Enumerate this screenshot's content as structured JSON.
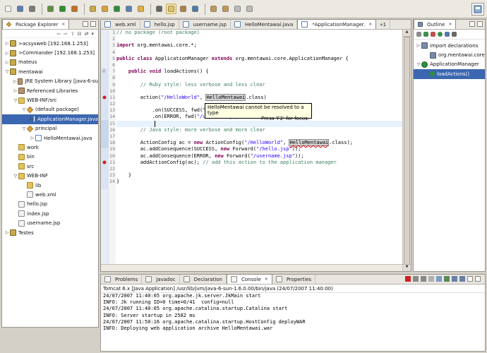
{
  "toolbar": {
    "icons": [
      "new-icon",
      "save-icon",
      "print-icon",
      "debug-icon",
      "run-icon",
      "external-tools-icon",
      "new-project-icon",
      "new-package-icon",
      "new-class-icon",
      "open-type-icon",
      "search-icon",
      "pin-icon",
      "mark-occurrences-icon",
      "annotation-icon",
      "web-icon",
      "next-annotation-icon",
      "prev-annotation-icon",
      "back-icon",
      "forward-icon"
    ],
    "perspective_icon": "java-perspective-icon"
  },
  "package_explorer": {
    "tab_label": "Package Explorer",
    "tab_close": "✕",
    "items": [
      {
        "indent": 0,
        "twisty": "▷",
        "icon": "project",
        "label": ">acsysweb  [192.168.1.253]"
      },
      {
        "indent": 0,
        "twisty": "▷",
        "icon": "project",
        "label": ">Commander  [192.168.1.253]"
      },
      {
        "indent": 0,
        "twisty": "▷",
        "icon": "project",
        "label": "mateus"
      },
      {
        "indent": 0,
        "twisty": "▽",
        "icon": "project",
        "label": "mentawai"
      },
      {
        "indent": 1,
        "twisty": "▷",
        "icon": "jar",
        "label": "JRE System Library [java-6-su"
      },
      {
        "indent": 1,
        "twisty": "▷",
        "icon": "jar",
        "label": "Referenced Libraries"
      },
      {
        "indent": 1,
        "twisty": "▽",
        "icon": "folder",
        "label": "WEB-INF/src"
      },
      {
        "indent": 2,
        "twisty": "▽",
        "icon": "pkg",
        "label": "(default package)"
      },
      {
        "indent": 3,
        "twisty": "▷",
        "icon": "java",
        "label": "ApplicationManager.java",
        "selected": true
      },
      {
        "indent": 2,
        "twisty": "▽",
        "icon": "pkg",
        "label": "principal"
      },
      {
        "indent": 3,
        "twisty": "▷",
        "icon": "java",
        "label": "HelloMentawai.java"
      },
      {
        "indent": 1,
        "twisty": "",
        "icon": "folder",
        "label": "work"
      },
      {
        "indent": 1,
        "twisty": "",
        "icon": "folder",
        "label": "bin"
      },
      {
        "indent": 1,
        "twisty": "",
        "icon": "folder",
        "label": "src"
      },
      {
        "indent": 1,
        "twisty": "▽",
        "icon": "folder",
        "label": "WEB-INF"
      },
      {
        "indent": 2,
        "twisty": "",
        "icon": "folder",
        "label": "lib"
      },
      {
        "indent": 2,
        "twisty": "",
        "icon": "file",
        "label": "web.xml"
      },
      {
        "indent": 1,
        "twisty": "",
        "icon": "file",
        "label": "hello.jsp"
      },
      {
        "indent": 1,
        "twisty": "",
        "icon": "file",
        "label": "index.jsp"
      },
      {
        "indent": 1,
        "twisty": "",
        "icon": "file",
        "label": "username.jsp"
      },
      {
        "indent": 0,
        "twisty": "▷",
        "icon": "project",
        "label": "Testes"
      }
    ]
  },
  "editor": {
    "tabs": [
      {
        "label": "web.xml",
        "active": false
      },
      {
        "label": "hello.jsp",
        "active": false
      },
      {
        "label": "username.jsp",
        "active": false
      },
      {
        "label": "HelloMentawai.java",
        "active": false
      },
      {
        "label": "*ApplicationManager.",
        "active": true,
        "close": "✕"
      }
    ],
    "overflow_label": "»1",
    "lines": [
      [
        {
          "t": "// no package (root package)",
          "c": "cm"
        }
      ],
      [],
      [
        {
          "t": "import",
          "c": "kw"
        },
        {
          "t": " org.mentawai.core.*;"
        }
      ],
      [],
      [
        {
          "t": "public class",
          "c": "kw"
        },
        {
          "t": " ApplicationManager "
        },
        {
          "t": "extends",
          "c": "kw"
        },
        {
          "t": " org.mentawai.core.ApplicationManager {"
        }
      ],
      [],
      [
        {
          "t": "    "
        },
        {
          "t": "public void",
          "c": "kw"
        },
        {
          "t": " loadActions() {"
        }
      ],
      [],
      [
        {
          "t": "        "
        },
        {
          "t": "// Ruby style: less verbose and less clear",
          "c": "cm"
        }
      ],
      [],
      [
        {
          "t": "        action("
        },
        {
          "t": "\"/HelloWorld\"",
          "c": "st"
        },
        {
          "t": ", "
        },
        {
          "t": "HelloMentawai",
          "c": "hl"
        },
        {
          "t": ".class)"
        }
      ],
      [],
      [
        {
          "t": "            .on(SUCCESS, fwd(\""
        }
      ],
      [
        {
          "t": "            .on(ERROR, fwd("
        },
        {
          "t": "\"/username.jsp\"",
          "c": "st"
        },
        {
          "t": "));"
        }
      ],
      [
        {
          "t": "",
          "c": "caret"
        }
      ],
      [
        {
          "t": "        "
        },
        {
          "t": "// Java style: more verbose and more clear",
          "c": "cm"
        }
      ],
      [],
      [
        {
          "t": "        ActionConfig ac = "
        },
        {
          "t": "new",
          "c": "kw"
        },
        {
          "t": " ActionConfig("
        },
        {
          "t": "\"/HelloWorld\"",
          "c": "st"
        },
        {
          "t": ", "
        },
        {
          "t": "HelloMentawai",
          "c": "hlerr"
        },
        {
          "t": ".class);"
        }
      ],
      [
        {
          "t": "        ac.addConsequence(SUCCESS, "
        },
        {
          "t": "new",
          "c": "kw"
        },
        {
          "t": " Forward("
        },
        {
          "t": "\"/hello.jsp\"",
          "c": "st"
        },
        {
          "t": "));"
        }
      ],
      [
        {
          "t": "        ac.addConsequence(ERROR, "
        },
        {
          "t": "new",
          "c": "kw"
        },
        {
          "t": " Forward("
        },
        {
          "t": "\"/username.jsp\"",
          "c": "st"
        },
        {
          "t": "));"
        }
      ],
      [
        {
          "t": "        addActionConfig(ac); "
        },
        {
          "t": "// add this action to the application manager",
          "c": "cm"
        }
      ],
      [],
      [
        {
          "t": "    }"
        }
      ],
      [
        {
          "t": "}"
        }
      ]
    ],
    "line_numbers": [
      "1",
      "2",
      "3",
      "4",
      "5",
      "6",
      "7",
      "8",
      "9",
      "10",
      "11",
      "12",
      "13",
      "14",
      "15",
      "16",
      "17",
      "18",
      "19",
      "20",
      "21",
      "22",
      "23",
      "24"
    ],
    "tooltip_message": "HelloMentawai cannot be resolved to a type",
    "tooltip_hint": "Press 'F2' for focus."
  },
  "outline": {
    "tab_label": "Outline",
    "tab_close": "✕",
    "items": [
      {
        "indent": 0,
        "twisty": "▷",
        "icon": "imports",
        "label": "import declarations"
      },
      {
        "indent": 1,
        "twisty": "",
        "icon": "imports",
        "label": "org.mentawai.core"
      },
      {
        "indent": 0,
        "twisty": "▽",
        "icon": "class",
        "label": "ApplicationManager"
      },
      {
        "indent": 1,
        "twisty": "",
        "icon": "method",
        "label": "loadActions()",
        "selected": true
      }
    ]
  },
  "console": {
    "tabs": [
      {
        "label": "Problems",
        "active": false
      },
      {
        "label": "Javadoc",
        "active": false
      },
      {
        "label": "Declaration",
        "active": false
      },
      {
        "label": "Console",
        "active": true,
        "close": "✕"
      },
      {
        "label": "Properties",
        "active": false
      }
    ],
    "title": "Tomcat 6.x [Java Application] /usr/lib/jvm/java-6-sun-1.6.0.00/bin/java (24/07/2007 11:40:00)",
    "lines": [
      "24/07/2007 11:40:05 org.apache.jk.server.JkMain start",
      "INFO: Jk running ID=0 time=0/41  config=null",
      "24/07/2007 11:40:05 org.apache.catalina.startup.Catalina start",
      "INFO: Server startup in 2582 ms",
      "24/07/2007 11:50:16 org.apache.catalina.startup.HostConfig deployWAR",
      "INFO: Deploying web application archive HelloMentawai.war"
    ]
  }
}
